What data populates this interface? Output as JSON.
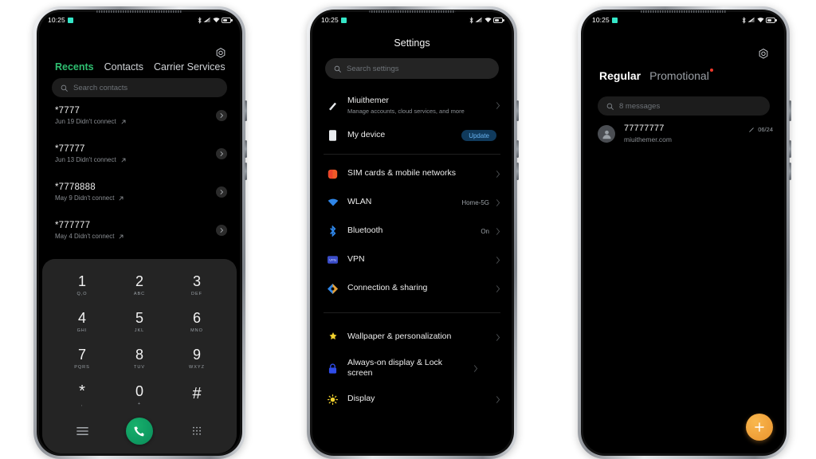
{
  "statusbar": {
    "time": "10:25",
    "icons": [
      "bluetooth-icon",
      "signal-icon",
      "wifi-icon",
      "battery-icon"
    ]
  },
  "phone1": {
    "app": "Dialer",
    "gear_icon": "settings-gear-icon",
    "tabs": [
      {
        "label": "Recents",
        "active": true
      },
      {
        "label": "Contacts",
        "active": false
      },
      {
        "label": "Carrier Services",
        "active": false
      }
    ],
    "search": {
      "placeholder": "Search contacts",
      "icon": "search-icon"
    },
    "calls": [
      {
        "number": "*7777",
        "detail": "Jun 19 Didn't connect"
      },
      {
        "number": "*77777",
        "detail": "Jun 13 Didn't connect"
      },
      {
        "number": "*7778888",
        "detail": "May 9 Didn't connect"
      },
      {
        "number": "*777777",
        "detail": "May 4 Didn't connect"
      }
    ],
    "dialpad": {
      "keys": [
        {
          "digit": "1",
          "letters": "Q,O"
        },
        {
          "digit": "2",
          "letters": "ABC"
        },
        {
          "digit": "3",
          "letters": "DEF"
        },
        {
          "digit": "4",
          "letters": "GHI"
        },
        {
          "digit": "5",
          "letters": "JKL"
        },
        {
          "digit": "6",
          "letters": "MNO"
        },
        {
          "digit": "7",
          "letters": "PQRS"
        },
        {
          "digit": "8",
          "letters": "TUV"
        },
        {
          "digit": "9",
          "letters": "WXYZ"
        },
        {
          "digit": "*",
          "letters": ","
        },
        {
          "digit": "0",
          "letters": "+"
        },
        {
          "digit": "#",
          "letters": ""
        }
      ],
      "menu_icon": "hamburger-menu-icon",
      "call_icon": "call-phone-icon",
      "keypad_icon": "keypad-grid-icon",
      "call_button_color": "#0f9b62"
    }
  },
  "phone2": {
    "title": "Settings",
    "search": {
      "placeholder": "Search settings",
      "icon": "search-icon"
    },
    "account": {
      "name": "Miuithemer",
      "subtitle": "Manage accounts, cloud services, and more",
      "icon": "account-avatar-icon"
    },
    "device": {
      "label": "My device",
      "badge": "Update",
      "icon": "device-phone-icon",
      "badge_color": "#68b3f0"
    },
    "group1": [
      {
        "label": "SIM cards & mobile networks",
        "value": "",
        "icon": "sim-card-icon",
        "color": "#f05a28"
      },
      {
        "label": "WLAN",
        "value": "Home-5G",
        "icon": "wifi-icon",
        "color": "#2f86e8"
      },
      {
        "label": "Bluetooth",
        "value": "On",
        "icon": "bluetooth-icon",
        "color": "#2f86e8"
      },
      {
        "label": "VPN",
        "value": "",
        "icon": "vpn-icon",
        "color": "#3a4cc8"
      },
      {
        "label": "Connection & sharing",
        "value": "",
        "icon": "connection-sharing-icon",
        "color": "#e8a033"
      }
    ],
    "group2": [
      {
        "label": "Wallpaper & personalization",
        "value": "",
        "icon": "wallpaper-icon",
        "color": "#f2d22e"
      },
      {
        "label": "Always-on display & Lock screen",
        "value": "",
        "icon": "lock-icon",
        "color": "#2f4ce8"
      },
      {
        "label": "Display",
        "value": "",
        "icon": "display-brightness-icon",
        "color": "#f2d22e"
      }
    ]
  },
  "phone3": {
    "app": "Messages",
    "gear_icon": "settings-gear-icon",
    "tabs": [
      {
        "label": "Regular",
        "active": true,
        "dot": false
      },
      {
        "label": "Promotional",
        "active": false,
        "dot": true
      }
    ],
    "search": {
      "placeholder": "8 messages",
      "icon": "search-icon"
    },
    "messages": [
      {
        "name": "77777777",
        "snippet": "miuithemer.com",
        "date": "06/24",
        "status_icon": "sent-check-icon",
        "avatar_icon": "person-avatar-icon"
      }
    ],
    "fab": {
      "icon": "plus-icon",
      "color": "#f0a13a"
    }
  }
}
